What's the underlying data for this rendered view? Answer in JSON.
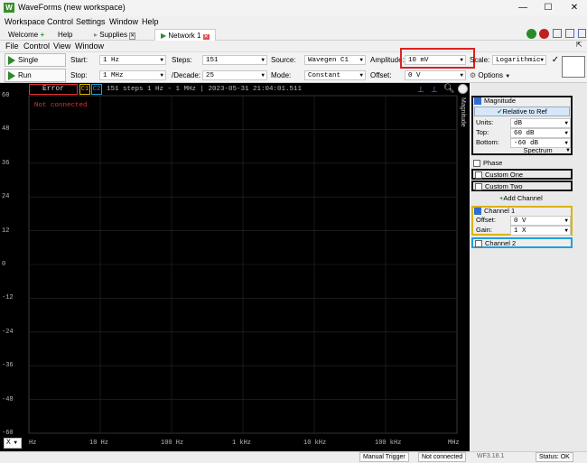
{
  "app": {
    "title": "WaveForms (new workspace)",
    "logo": "W"
  },
  "menu": [
    "Workspace",
    "Control",
    "Settings",
    "Window",
    "Help"
  ],
  "tabs": {
    "welcome": "Welcome",
    "help": "Help",
    "supplies": "Supplies",
    "network": "Network 1"
  },
  "submenu": [
    "File",
    "Control",
    "View",
    "Window"
  ],
  "toolbar": {
    "single": "Single",
    "run": "Run",
    "start_label": "Start:",
    "start": "1 Hz",
    "stop_label": "Stop:",
    "stop": "1 MHz",
    "steps_label": "Steps:",
    "steps": "151",
    "decade_label": "/Decade:",
    "decade": "25",
    "source_label": "Source:",
    "source": "Wavegen C1",
    "mode_label": "Mode:",
    "mode": "Constant",
    "amp_label": "Amplitude:",
    "amp": "10 mV",
    "offset_label": "Offset:",
    "offset": "0 V",
    "scale_label": "Scale:",
    "scale": "Logarithmic",
    "options": "Options"
  },
  "plot": {
    "error": "Error",
    "c1": "C1",
    "c2": "C2",
    "info": "151 steps  1 Hz - 1 MHz | 2023-05-31 21:04:01.511",
    "notconn": "Not connected",
    "side": "Magnitude",
    "yticks": [
      "60",
      "48",
      "36",
      "24",
      "12",
      "0",
      "-12",
      "-24",
      "-36",
      "-48",
      "-60"
    ],
    "xticks": [
      "Hz",
      "10 Hz",
      "100 Hz",
      "1 kHz",
      "10 kHz",
      "100 kHz",
      "MHz"
    ],
    "xsel": "X"
  },
  "panel": {
    "magnitude": "Magnitude",
    "relative": "Relative to Ref",
    "units_label": "Units:",
    "units": "dB",
    "top_label": "Top:",
    "top": "60 dB",
    "bottom_label": "Bottom:",
    "bottom": "-60 dB",
    "spectrum": "Spectrum",
    "phase": "Phase",
    "custom1": "Custom One",
    "custom2": "Custom Two",
    "addchannel": "Add Channel",
    "ch1": "Channel 1",
    "offset_label": "Offset:",
    "offset": "0 V",
    "gain_label": "Gain:",
    "gain": "1 X",
    "ch2": "Channel 2"
  },
  "status": {
    "manual": "Manual Trigger",
    "conn": "Not connected",
    "ver": "WF3.18.1",
    "statusok": "Status: OK"
  },
  "colors": {
    "accent": "#2d6fd0",
    "ch1": "#d9b400",
    "ch2": "#22a0d8",
    "error": "#e03030"
  }
}
